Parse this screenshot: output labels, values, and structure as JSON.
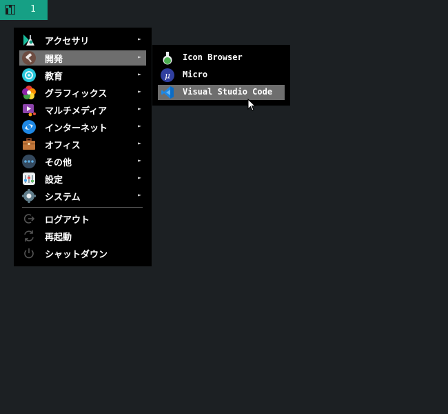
{
  "panel": {
    "workspace_label": "1",
    "accent": "#16a085",
    "logo_icon": "manjaro-logo-icon"
  },
  "main_menu": {
    "items": [
      {
        "label": "アクセサリ",
        "icon": "accessories-icon",
        "has_submenu": true,
        "selected": false
      },
      {
        "label": "開発",
        "icon": "development-hammer-icon",
        "has_submenu": true,
        "selected": true
      },
      {
        "label": "教育",
        "icon": "education-icon",
        "has_submenu": true,
        "selected": false
      },
      {
        "label": "グラフィックス",
        "icon": "graphics-icon",
        "has_submenu": true,
        "selected": false
      },
      {
        "label": "マルチメディア",
        "icon": "multimedia-icon",
        "has_submenu": true,
        "selected": false
      },
      {
        "label": "インターネット",
        "icon": "internet-icon",
        "has_submenu": true,
        "selected": false
      },
      {
        "label": "オフィス",
        "icon": "office-briefcase-icon",
        "has_submenu": true,
        "selected": false
      },
      {
        "label": "その他",
        "icon": "other-dots-icon",
        "has_submenu": true,
        "selected": false
      },
      {
        "label": "設定",
        "icon": "settings-icon",
        "has_submenu": true,
        "selected": false
      },
      {
        "label": "システム",
        "icon": "system-gear-icon",
        "has_submenu": true,
        "selected": false
      }
    ],
    "actions": [
      {
        "label": "ログアウト",
        "icon": "logout-icon"
      },
      {
        "label": "再起動",
        "icon": "restart-icon"
      },
      {
        "label": "シャットダウン",
        "icon": "power-icon"
      }
    ],
    "submenu_arrow": "►"
  },
  "submenu": {
    "items": [
      {
        "label": "Icon Browser",
        "icon": "icon-browser-flask-icon",
        "selected": false
      },
      {
        "label": "Micro",
        "icon": "micro-editor-icon",
        "selected": false
      },
      {
        "label": "Visual Studio Code",
        "icon": "vscode-icon",
        "selected": true
      }
    ],
    "highlight_color": "#6e6e6e"
  }
}
